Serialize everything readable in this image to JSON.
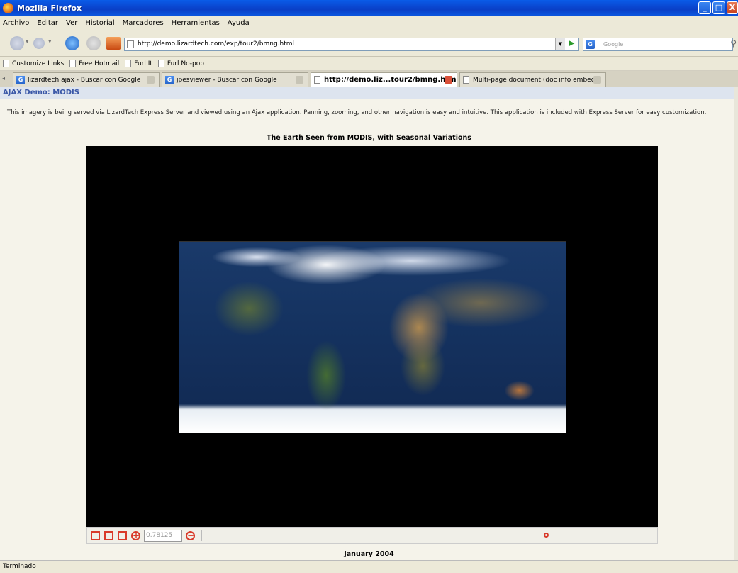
{
  "window": {
    "title": "Mozilla Firefox",
    "buttons": {
      "minimize": "_",
      "maximize": "□",
      "close": "X"
    }
  },
  "menu": [
    "Archivo",
    "Editar",
    "Ver",
    "Historial",
    "Marcadores",
    "Herramientas",
    "Ayuda"
  ],
  "toolbar": {
    "url": "http://demo.lizardtech.com/exp/tour2/bmng.html",
    "search_placeholder": "Google",
    "search_engine_icon": "G"
  },
  "bookmarks": [
    "Customize Links",
    "Free Hotmail",
    "Furl It",
    "Furl No-pop"
  ],
  "tabs": [
    {
      "label": "lizardtech ajax - Buscar con Google",
      "icon": "google-favicon",
      "active": false
    },
    {
      "label": "jpesviewer - Buscar con Google",
      "icon": "google-favicon",
      "active": false
    },
    {
      "label": "http://demo.liz...tour2/bmng.html",
      "icon": "page-icon",
      "active": true
    },
    {
      "label": "Multi-page document (doc info embed...",
      "icon": "page-icon",
      "active": false
    }
  ],
  "page": {
    "header": "AJAX Demo: MODIS",
    "intro": "This imagery is being served via LizardTech Express Server and viewed using an Ajax application. Panning, zooming, and other navigation is easy and intuitive. This application is included with Express Server for easy customization.",
    "map_title": "The Earth Seen from MODIS, with Seasonal Variations",
    "zoom_value": "0.78125",
    "caption": "January 2004"
  },
  "status": "Terminado"
}
